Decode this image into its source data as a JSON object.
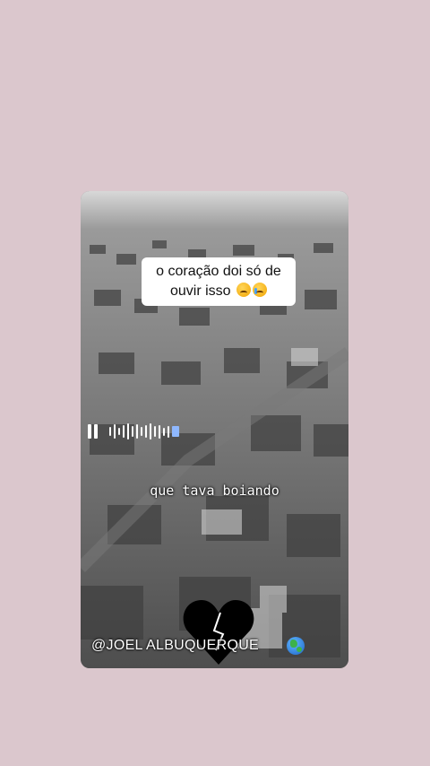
{
  "caption": {
    "line1": "o coração doi só de",
    "line2": "ouvir isso",
    "emojis": [
      "weary-face",
      "crying-face"
    ]
  },
  "subtitle": "que tava boiando",
  "watermark": "@JOEL ALBUQUERQUE",
  "icons": {
    "audio": "pause-icon",
    "heart": "broken-heart-icon",
    "globe": "globe-icon"
  },
  "colors": {
    "background": "#dbc7cd",
    "waveform_active": "#8fb8ff"
  }
}
